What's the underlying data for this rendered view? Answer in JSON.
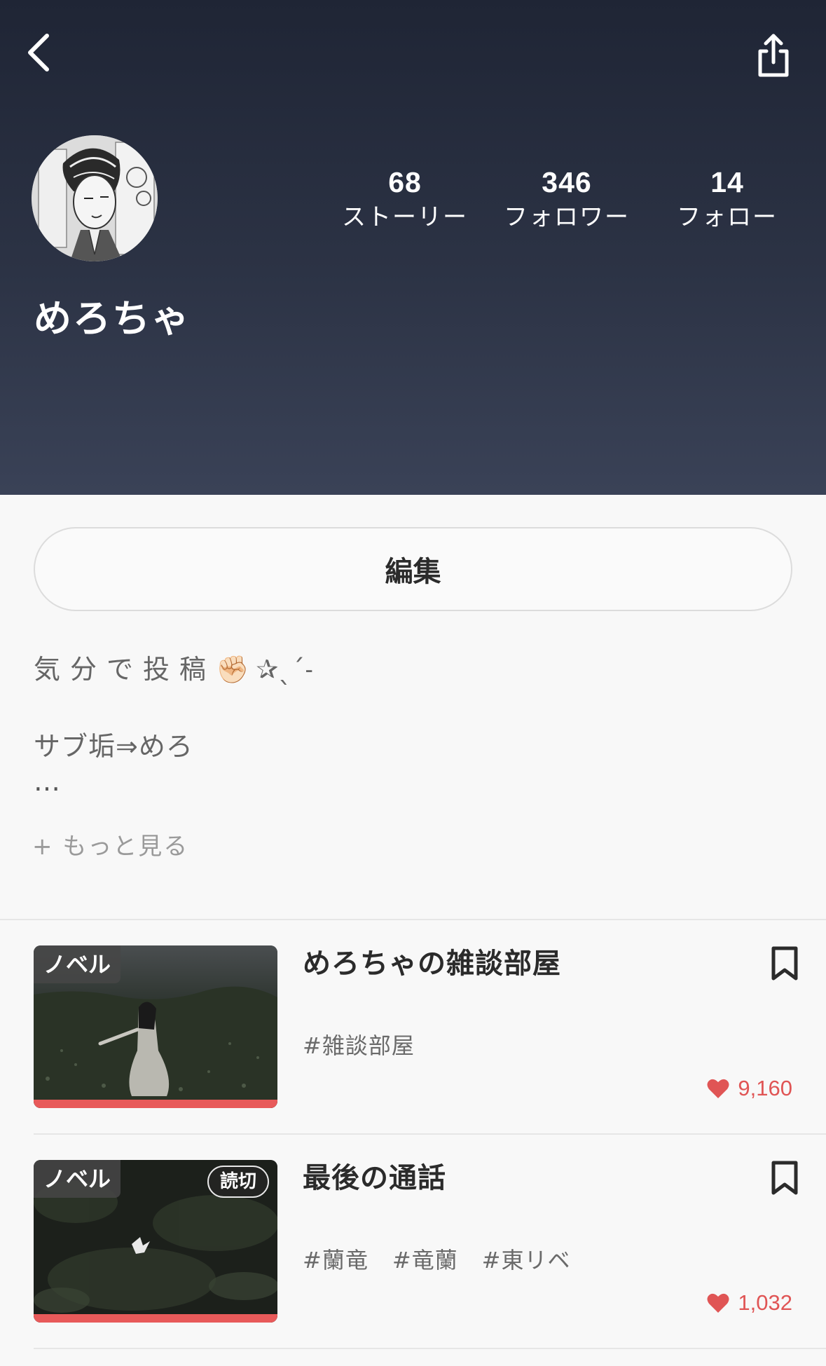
{
  "header": {
    "back_icon": "chevron-left-icon",
    "share_icon": "share-icon",
    "username": "めろちゃ",
    "stats": [
      {
        "value": "68",
        "label": "ストーリー"
      },
      {
        "value": "346",
        "label": "フォロワー"
      },
      {
        "value": "14",
        "label": "フォロー"
      }
    ]
  },
  "profile": {
    "edit_label": "編集",
    "bio_line1_text": "気分で投稿",
    "bio_line1_emoji": "✊🏻",
    "bio_line1_suffix": "✰ˎˊ˗",
    "bio_line2": "サブ垢⇒めろ",
    "bio_line3": "…",
    "more_label": "+ もっと見る"
  },
  "stories": [
    {
      "genre": "ノベル",
      "badge": "",
      "title": "めろちゃの雑談部屋",
      "tags": [
        "#雑談部屋"
      ],
      "likes": "9,160"
    },
    {
      "genre": "ノベル",
      "badge": "読切",
      "title": "最後の通話",
      "tags": [
        "#蘭竜",
        "#竜蘭",
        "#東リベ"
      ],
      "likes": "1,032"
    }
  ],
  "colors": {
    "header_top": "#1f2535",
    "header_bottom": "#3a4257",
    "accent_red": "#e85a5a",
    "like_red": "#e05555"
  }
}
